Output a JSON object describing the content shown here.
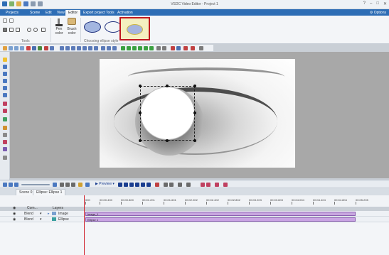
{
  "window": {
    "title": "VSDC Video Editor - Project 1"
  },
  "menu": {
    "tabs": [
      "Projects",
      "Scene",
      "Edit",
      "View",
      "Editor",
      "Export project",
      "Tools",
      "Activation"
    ],
    "active": "Editor",
    "options_label": "Options"
  },
  "ribbon": {
    "tools_group_label": "Tools",
    "pen_label": "Pen",
    "pen_sub": "color",
    "brush_label": "Brush",
    "brush_sub": "color",
    "ellipse_group_label": "Choosing ellipse style",
    "colors": {
      "selected_border": "#c0181f",
      "ellipse_fill": "#a3b6e0",
      "ellipse_stroke": "#1b2d7a"
    }
  },
  "timeline": {
    "preview_label": "Preview",
    "tabs": [
      "Scene 0",
      "Ellipse: Ellipse 1"
    ],
    "header": {
      "com_label": "Com...",
      "layers_label": "Layers"
    },
    "ruler": [
      "000",
      "00:00.400",
      "00:00.800",
      "00:01.201",
      "00:01.601",
      "00:02.002",
      "00:02.402",
      "00:02.802",
      "00:03.203",
      "00:03.603",
      "00:04.004",
      "00:04.404",
      "00:04.804",
      "00:05.205"
    ],
    "tracks": [
      {
        "blend": "Blend",
        "layer": "Image",
        "clip": "image_1"
      },
      {
        "blend": "Blend",
        "layer": "Ellipse",
        "clip": "Ellipse 1"
      }
    ]
  }
}
